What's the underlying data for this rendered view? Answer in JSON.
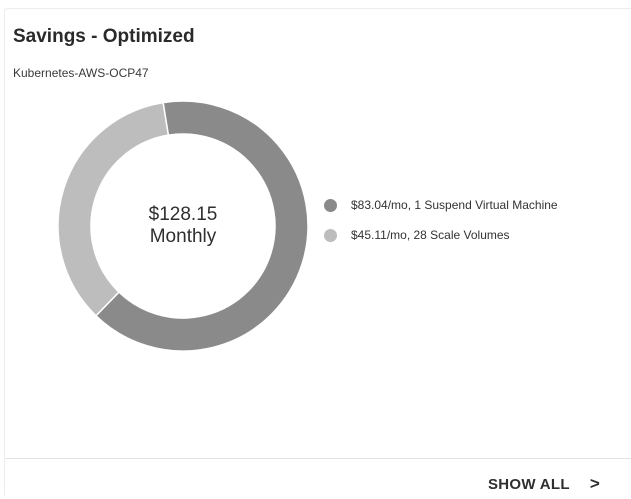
{
  "card": {
    "title": "Savings - Optimized",
    "subtitle": "Kubernetes-AWS-OCP47"
  },
  "center": {
    "amount": "$128.15",
    "period": "Monthly"
  },
  "colors": {
    "dark_segment": "#8a8a8a",
    "light_segment": "#bdbdbd"
  },
  "chart_data": {
    "type": "pie",
    "donut": true,
    "categories": [
      "$83.04/mo, 1 Suspend Virtual Machine",
      "$45.11/mo, 28 Scale Volumes"
    ],
    "values": [
      83.04,
      45.11
    ],
    "colors": [
      "#8a8a8a",
      "#bdbdbd"
    ],
    "legend_position": "right"
  },
  "footer": {
    "show_all_label": "SHOW ALL",
    "chevron": ">"
  }
}
